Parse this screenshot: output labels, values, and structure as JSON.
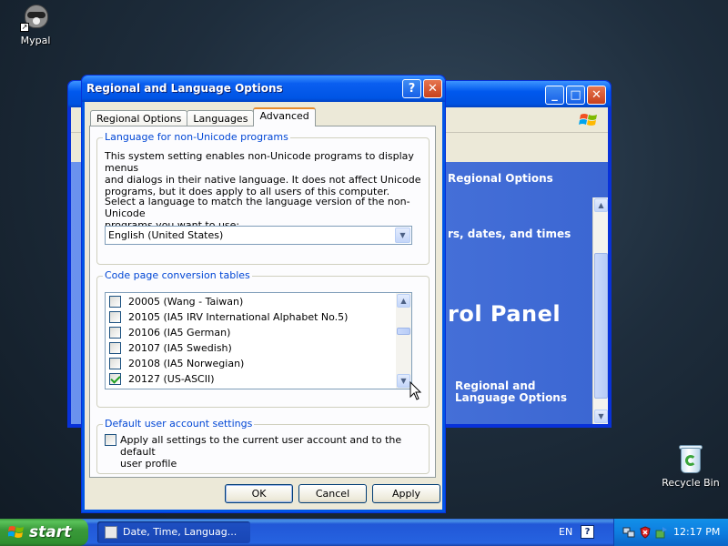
{
  "desktop": {
    "icons": [
      {
        "label": "Mypal",
        "icon": "raccoon-icon"
      },
      {
        "label": "Recycle Bin",
        "icon": "recycle-bin-icon"
      }
    ]
  },
  "background_window": {
    "content": {
      "link_regional": "Regional Options",
      "category": "rs, dates, and times",
      "heading": "rol Panel",
      "item": [
        "Regional and",
        "Language Options"
      ]
    }
  },
  "dialog": {
    "title": "Regional and Language Options",
    "tabs": [
      {
        "label": "Regional Options",
        "active": false
      },
      {
        "label": "Languages",
        "active": false
      },
      {
        "label": "Advanced",
        "active": true
      }
    ],
    "non_unicode": {
      "label": "Language for non-Unicode programs",
      "description": [
        "This system setting enables non-Unicode programs to display menus",
        "and dialogs in their native language. It does not affect Unicode",
        "programs, but it does apply to all users of this computer."
      ],
      "prompt": [
        "Select a language to match the language version of the non-Unicode",
        "programs you want to use:"
      ],
      "selected_language": "English (United States)"
    },
    "code_pages": {
      "label": "Code page conversion tables",
      "items": [
        {
          "label": "20005 (Wang - Taiwan)",
          "checked": false
        },
        {
          "label": "20105 (IA5 IRV International Alphabet No.5)",
          "checked": false
        },
        {
          "label": "20106 (IA5 German)",
          "checked": false
        },
        {
          "label": "20107 (IA5 Swedish)",
          "checked": false
        },
        {
          "label": "20108 (IA5 Norwegian)",
          "checked": false
        },
        {
          "label": "20127 (US-ASCII)",
          "checked": true
        }
      ]
    },
    "default_user": {
      "label": "Default user account settings",
      "checkbox_label": [
        "Apply all settings to the current user account and to the default",
        "user profile"
      ],
      "checked": false
    },
    "buttons": {
      "ok": "OK",
      "cancel": "Cancel",
      "apply": "Apply"
    }
  },
  "taskbar": {
    "start_label": "start",
    "task": "Date, Time, Languag...",
    "language": "EN",
    "help": "?",
    "time": "12:17 PM"
  }
}
